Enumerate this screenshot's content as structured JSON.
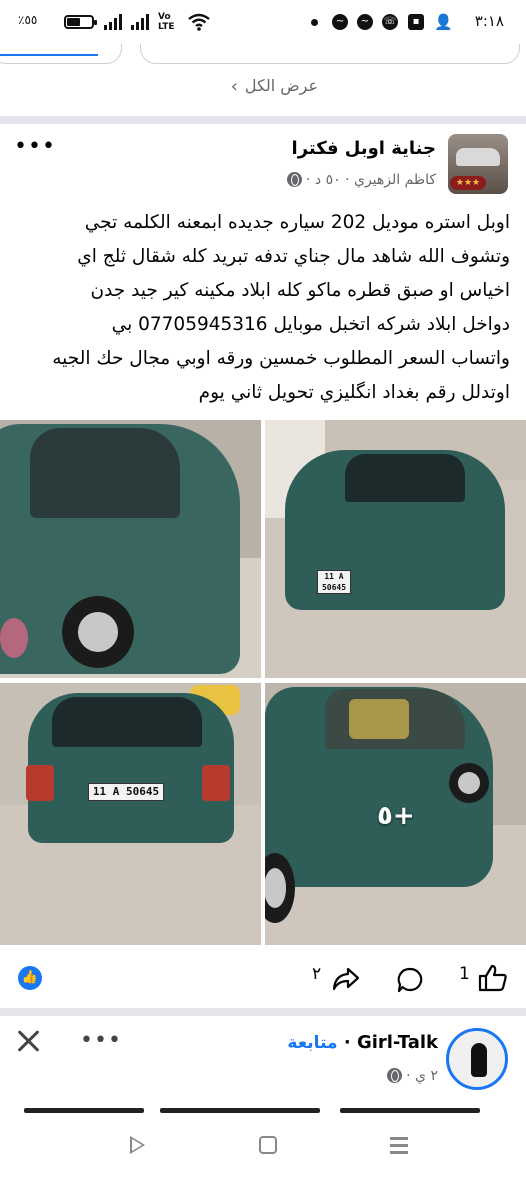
{
  "status_bar": {
    "time": "٣:١٨",
    "battery_percent": "٪٥٥",
    "battery_level": 0.55,
    "network_label": "Vo LTE",
    "icons": [
      "signal-icon",
      "signal-icon",
      "wifi-icon",
      "messenger-icon",
      "messenger-icon",
      "whatsapp-icon",
      "gallery-icon",
      "add-user-icon"
    ]
  },
  "feed": {
    "see_all_label": "عرض الكل"
  },
  "post": {
    "group_name": "جناية اوبل فكترا",
    "author": "كاظم الزهيري",
    "time": "٥٠ د",
    "separator": "·",
    "body_lines": [
      "اوبل استره موديل 202 سياره جديده ابمعنه الكلمه تجي",
      "وتشوف الله شاهد مال جناي تدفه تبريد كله شقال ثلج اي",
      "اخياس او صبق قطره ماكو كله ابلاد مكينه كير جيد جدن",
      "دواخل ابلاد شركه اتخبل موبايل 07705945316 بي",
      "واتساب السعر المطلوب خمسين ورقه اوبي مجال حك الجيه",
      "اوتدلل رقم بغداد انگليزي تحويل ثاني يوم"
    ],
    "photos": [
      {
        "name": "car-side-photo"
      },
      {
        "name": "car-front-photo",
        "plate": "11 A 50645"
      },
      {
        "name": "car-rear-photo",
        "plate": "11 A 50645"
      },
      {
        "name": "car-left-side-photo",
        "more_label": "+٥"
      }
    ],
    "reaction_count_like": "1",
    "share_count": "٢"
  },
  "post2": {
    "name": "Girl-Talk",
    "follow_label": "متابعة",
    "separator": "·",
    "time": "٢ ي"
  },
  "colors": {
    "accent": "#1877f2",
    "meta_text": "#65676b",
    "separator": "#e4e6eb",
    "car_green": "#2f5e58"
  }
}
